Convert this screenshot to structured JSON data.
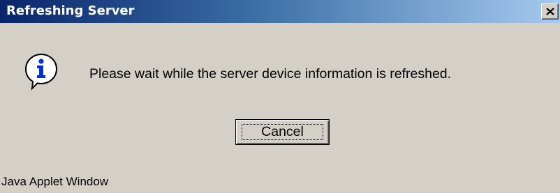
{
  "window": {
    "title": "Refreshing Server",
    "close_icon": "close-icon"
  },
  "dialog": {
    "icon": "info-icon",
    "message": "Please wait while the server device information is refreshed.",
    "cancel_label": "Cancel"
  },
  "status": {
    "text": "Java Applet Window"
  },
  "colors": {
    "title_gradient_start": "#0a246a",
    "title_gradient_end": "#a6caf0",
    "dialog_background": "#d4d0c8",
    "title_text": "#ffffff"
  }
}
